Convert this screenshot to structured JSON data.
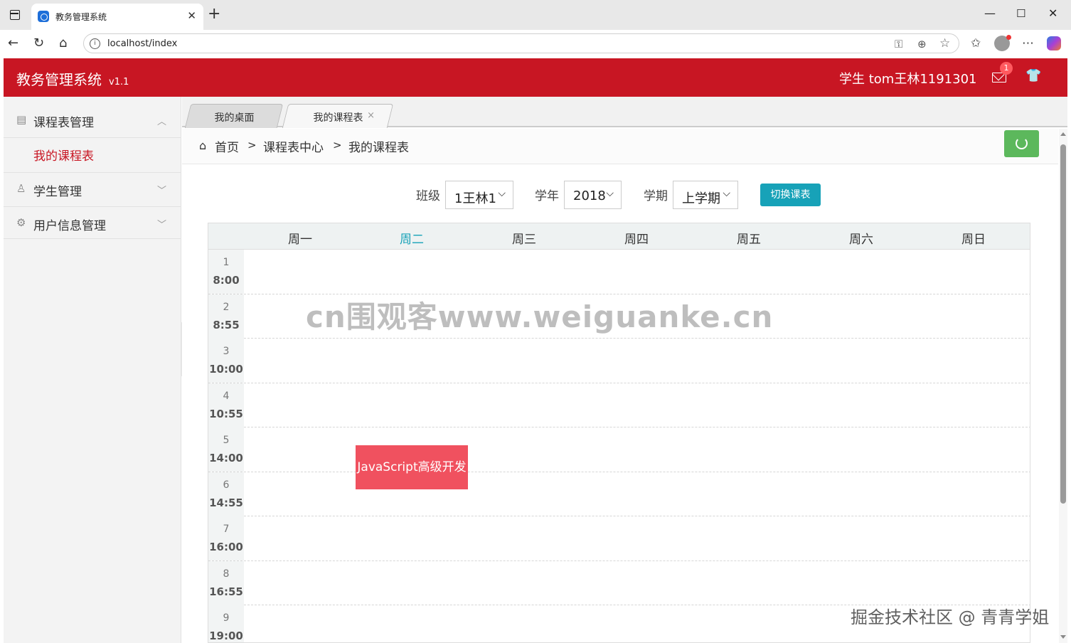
{
  "browser": {
    "tab_title": "教务管理系统",
    "url": "localhost/index"
  },
  "app": {
    "title": "教务管理系统",
    "version": "v1.1",
    "user_label": "学生  tom王林1191301",
    "mail_badge": "1",
    "header_color": "#c81623"
  },
  "sidebar": {
    "groups": [
      {
        "label": "课程表管理",
        "icon": "list-icon",
        "expanded": true,
        "items": [
          {
            "label": "我的课程表",
            "active": true
          }
        ]
      },
      {
        "label": "学生管理",
        "icon": "user-icon",
        "expanded": false
      },
      {
        "label": "用户信息管理",
        "icon": "gear-icon",
        "expanded": false
      }
    ]
  },
  "page_tabs": [
    {
      "label": "我的桌面",
      "active": false
    },
    {
      "label": "我的课程表",
      "active": true,
      "close": "×"
    }
  ],
  "breadcrumb": {
    "items": [
      "首页",
      "课程表中心",
      "我的课程表"
    ],
    "separator": ">"
  },
  "filters": {
    "class_label": "班级",
    "class_value": "1王林1",
    "year_label": "学年",
    "year_value": "2018",
    "term_label": "学期",
    "term_value": "上学期",
    "switch_button": "切换课表"
  },
  "timetable": {
    "days": [
      "周一",
      "周二",
      "周三",
      "周四",
      "周五",
      "周六",
      "周日"
    ],
    "current_day_index": 1,
    "periods": [
      {
        "n": "1",
        "time": "8:00"
      },
      {
        "n": "2",
        "time": "8:55"
      },
      {
        "n": "3",
        "time": "10:00"
      },
      {
        "n": "4",
        "time": "10:55"
      },
      {
        "n": "5",
        "time": "14:00"
      },
      {
        "n": "6",
        "time": "14:55"
      },
      {
        "n": "7",
        "time": "16:00"
      },
      {
        "n": "8",
        "time": "16:55"
      },
      {
        "n": "9",
        "time": "19:00"
      }
    ],
    "courses": [
      {
        "name": "JavaScript高级开发",
        "day": "周二",
        "period": "6",
        "color": "#f0515f"
      }
    ]
  },
  "watermarks": {
    "center": "cn围观客www.weiguanke.cn",
    "corner": "掘金技术社区 @ 青青学姐"
  }
}
